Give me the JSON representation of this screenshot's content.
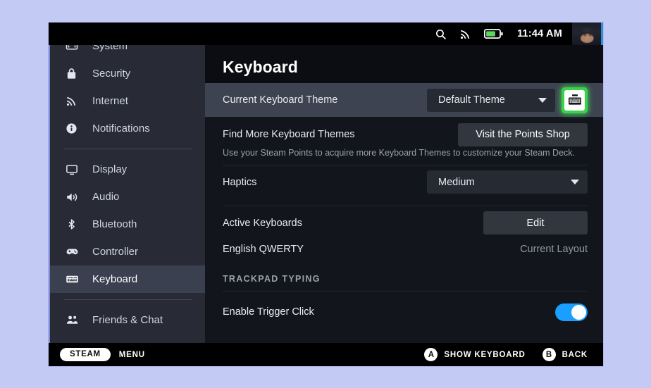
{
  "statusbar": {
    "search_icon": "search-icon",
    "wifi_icon": "wifi-icon",
    "battery_icon": "battery-icon",
    "time": "11:44 AM",
    "avatar": "user-avatar"
  },
  "sidebar": {
    "items": [
      {
        "label": "System",
        "icon": "system-icon",
        "active": false
      },
      {
        "label": "Security",
        "icon": "lock-icon",
        "active": false
      },
      {
        "label": "Internet",
        "icon": "wifi-icon",
        "active": false
      },
      {
        "label": "Notifications",
        "icon": "notifications-icon",
        "active": false
      },
      {
        "label": "Display",
        "icon": "display-icon",
        "active": false
      },
      {
        "label": "Audio",
        "icon": "audio-icon",
        "active": false
      },
      {
        "label": "Bluetooth",
        "icon": "bluetooth-icon",
        "active": false
      },
      {
        "label": "Controller",
        "icon": "controller-icon",
        "active": false
      },
      {
        "label": "Keyboard",
        "icon": "keyboard-icon",
        "active": true
      },
      {
        "label": "Friends & Chat",
        "icon": "friends-icon",
        "active": false
      }
    ]
  },
  "main": {
    "title": "Keyboard",
    "theme_row": {
      "label": "Current Keyboard Theme",
      "selected": "Default Theme",
      "preview_icon": "keyboard-icon"
    },
    "find_row": {
      "label": "Find More Keyboard Themes",
      "button": "Visit the Points Shop",
      "description": "Use your Steam Points to acquire more Keyboard Themes to customize your Steam Deck."
    },
    "haptics_row": {
      "label": "Haptics",
      "selected": "Medium"
    },
    "active_keyboards_row": {
      "label": "Active Keyboards",
      "button": "Edit"
    },
    "layout_row": {
      "label": "English QWERTY",
      "status": "Current Layout"
    },
    "trackpad_section": {
      "heading": "TRACKPAD TYPING",
      "trigger_click": {
        "label": "Enable Trigger Click",
        "enabled": "on"
      }
    }
  },
  "bottombar": {
    "steam_button": "STEAM",
    "menu_label": "MENU",
    "actions": [
      {
        "key": "A",
        "label": "SHOW KEYBOARD"
      },
      {
        "key": "B",
        "label": "BACK"
      }
    ]
  },
  "colors": {
    "page_background": "#c3cbf4",
    "sidebar": "#282b36",
    "content": "#12151c",
    "highlight_row": "#3d4351",
    "focus_green": "#3ad24a",
    "toggle_blue": "#1a9fff",
    "battery_green": "#5cd65c"
  }
}
